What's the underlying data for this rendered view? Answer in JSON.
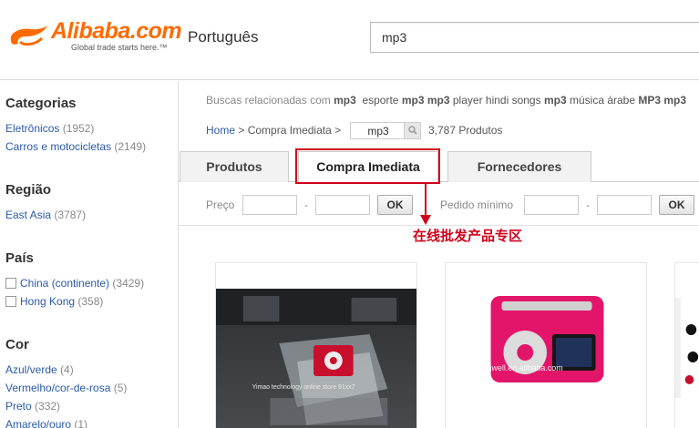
{
  "header": {
    "logo_text": "Alibaba.com",
    "logo_tagline": "Global trade starts here.™",
    "language": "Português",
    "search_value": "mp3"
  },
  "sidebar": {
    "sections": [
      {
        "title": "Categorias",
        "items": [
          {
            "label": "Eletrônicos",
            "count": "(1952)"
          },
          {
            "label": "Carros e motocicletas",
            "count": "(2149)"
          }
        ]
      },
      {
        "title": "Região",
        "items": [
          {
            "label": "East Asia",
            "count": "(3787)"
          }
        ]
      },
      {
        "title": "País",
        "items": [
          {
            "label": "China (continente)",
            "count": "(3429)"
          },
          {
            "label": "Hong Kong",
            "count": "(358)"
          }
        ]
      },
      {
        "title": "Cor",
        "items": [
          {
            "label": "Azul/verde",
            "count": "(4)"
          },
          {
            "label": "Vermelho/cor-de-rosa",
            "count": "(5)"
          },
          {
            "label": "Preto",
            "count": "(332)"
          },
          {
            "label": "Amarelo/ouro",
            "count": "(1)"
          }
        ]
      }
    ]
  },
  "related": {
    "prefix": "Buscas relacionadas com",
    "keyword": "mp3",
    "links": [
      {
        "pre": "esporte",
        "bold": "mp3"
      },
      {
        "bold": "mp3",
        "post": "player hindi songs"
      },
      {
        "bold": "mp3",
        "post": "música árabe"
      },
      {
        "bold": "MP3 mp3"
      }
    ]
  },
  "breadcrumb": {
    "home": "Home",
    "sep": ">",
    "current": "Compra Imediata",
    "query": "mp3",
    "count": "3,787 Produtos"
  },
  "tabs": [
    {
      "label": "Produtos",
      "active": false
    },
    {
      "label": "Compra Imediata",
      "active": true
    },
    {
      "label": "Fornecedores",
      "active": false
    }
  ],
  "filters": {
    "price_label": "Preço",
    "min_order_label": "Pedido mínimo",
    "dash": "-",
    "ok": "OK"
  },
  "annotation": {
    "text": "在线批发产品专区",
    "color": "#d0021b"
  },
  "products": [
    {
      "image_text": "Yimao technology   online store 91xx7",
      "image": "red-mp3-player-in-plastic-case"
    },
    {
      "image_text": "szjwell.en.alibaba.com",
      "image": "pink-mp3-player"
    },
    {
      "image": "partial-product-image"
    }
  ],
  "colors": {
    "brand": "#ff6a00",
    "link": "#2a5aa8",
    "annotation": "#d0021b"
  }
}
